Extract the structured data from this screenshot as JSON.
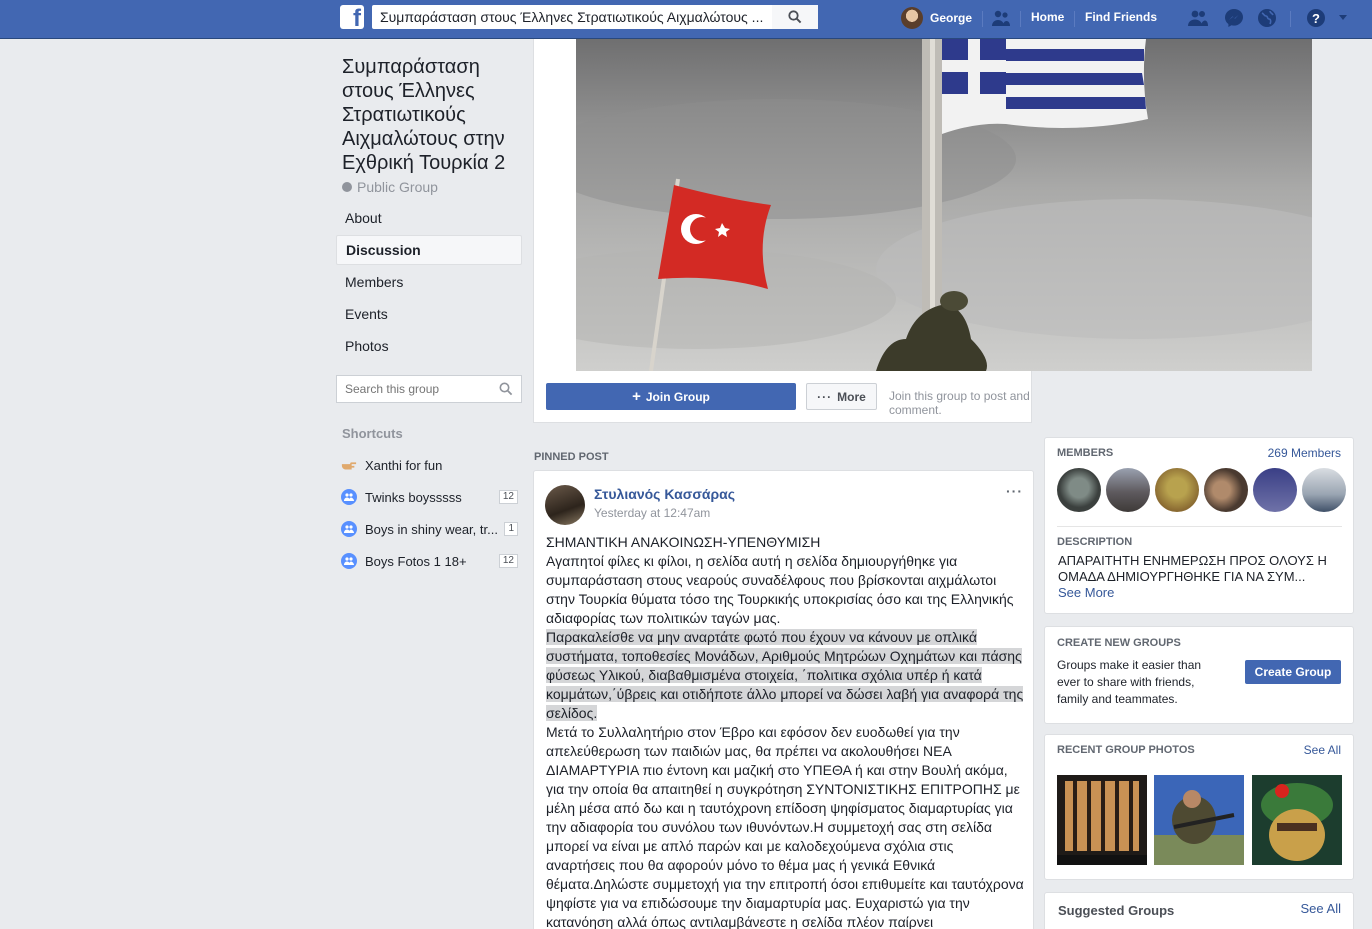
{
  "topbar": {
    "search_value": "Συμπαράσταση στους Έλληνες Στρατιωτικούς Αιχμαλώτους ...",
    "user_name": "George",
    "home_label": "Home",
    "find_friends_label": "Find Friends",
    "brand_color": "#4267b2"
  },
  "group": {
    "title": "Συμπαράσταση στους Έλληνες Στρατιωτικούς Αιχμαλώτους στην Εχθρική Τουρκία 2",
    "type": "Public Group"
  },
  "menu": [
    {
      "label": "About"
    },
    {
      "label": "Discussion",
      "active": true
    },
    {
      "label": "Members"
    },
    {
      "label": "Events"
    },
    {
      "label": "Photos"
    }
  ],
  "group_search": {
    "placeholder": "Search this group"
  },
  "shortcuts": {
    "heading": "Shortcuts",
    "items": [
      {
        "label": "Xanthi for fun",
        "badge": ""
      },
      {
        "label": "Twinks boysssss",
        "badge": "12"
      },
      {
        "label": "Boys in shiny wear, tr...",
        "badge": "1"
      },
      {
        "label": "Boys Fotos 1 18+",
        "badge": "12"
      }
    ]
  },
  "actions": {
    "join_label": "Join Group",
    "more_label": "More",
    "join_hint": "Join this group to post and comment."
  },
  "pinned_label": "PINNED POST",
  "post": {
    "author": "Στυλιανός Κασσάρας",
    "time": "Yesterday at 12:47am",
    "title_line": "ΣΗΜΑΝΤΙΚΗ ΑΝΑΚΟΙΝΩΣΗ-ΥΠΕΝΘΥΜΙΣΗ",
    "paragraph1": "Αγαπητοί φίλες κι φίλοι, η σελίδα αυτή η σελίδα δημιουργήθηκε για συμπαράσταση στους νεαρούς συναδέλφους που βρίσκονται αιχμάλωτοι στην Τουρκία θύματα τόσο της Τουρκικής υποκρισίας όσο και της Ελληνικής αδιαφορίας των πολιτικών ταγών μας.",
    "highlighted": "Παρακαλείσθε να μην αναρτάτε φωτό που έχουν να κάνουν με οπλικά συστήματα, τοποθεσίες Μονάδων, Αριθμούς Μητρώων Οχημάτων και πάσης φύσεως Υλικού, διαβαθμισμένα στοιχεία, ΄πολιτικα σχόλια υπέρ ή κατά κομμάτων,΄ύβρεις και οτιδήποτε άλλο μπορεί να δώσει λαβή για αναφορά της σελίδος.",
    "paragraph2": "Μετά το Συλλαλητήριο στον Έβρο και εφόσον δεν ευοδωθεί για την απελεύθερωση των παιδιών μας, θα πρέπει να ακολουθήσει ΝΕΑ ΔΙΑΜΑΡΤΥΡΙΑ πιο έντονη και μαζική στο ΥΠΕΘΑ ή και στην Βουλή ακόμα, για την οποία θα απαιτηθεί η συγκρότηση ΣΥΝΤΟΝΙΣΤΙΚΗΣ ΕΠΙΤΡΟΠΗΣ με μέλη μέσα από δω και η ταυτόχρονη επίδοση ψηφίσματος διαμαρτυρίας για την αδιαφορία του συνόλου των ιθυνόντων.Η συμμετοχή σας στη σελίδα μπορεί να είναι με απλό παρών και με καλοδεχούμενα σχόλια στις αναρτήσεις που θα αφορούν μόνο το θέμα μας ή γενικά Εθνικά θέματα.Δηλώστε συμμετοχή για την επιτροπή όσοι επιθυμείτε και ταυτόχρονα ψηφίστε για να επιδώσουμε την διαμαρτυρία μας. Ευχαριστώ για την κατανόηση αλλά όπως αντιλαμβάνεστε η σελίδα πλέον παίρνει"
  },
  "members_card": {
    "heading": "MEMBERS",
    "count": "269 Members",
    "desc_heading": "DESCRIPTION",
    "desc_text": "ΑΠΑΡΑΙΤΗΤΗ ΕΝΗΜΕΡΩΣΗ ΠΡΟΣ ΟΛΟΥΣ Η ΟΜΑΔΑ ΔΗΜΙΟΥΡΓΗΘΗΚΕ ΓΙΑ ΝΑ ΣΥΜ...",
    "see_more": "See More"
  },
  "create_card": {
    "heading": "CREATE NEW GROUPS",
    "text": "Groups make it easier than ever to share with friends, family and teammates.",
    "button": "Create Group"
  },
  "photos_card": {
    "heading": "RECENT GROUP PHOTOS",
    "see_all": "See All"
  },
  "suggested_card": {
    "heading": "Suggested Groups",
    "see_all": "See All"
  }
}
